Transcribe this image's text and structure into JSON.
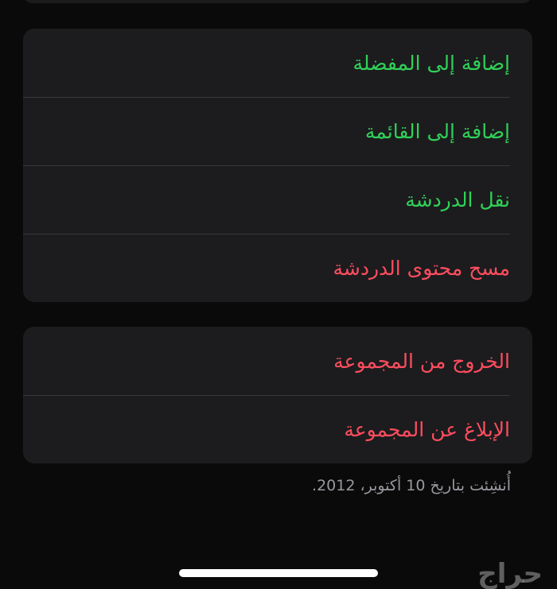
{
  "group_options": {
    "items": [
      {
        "label": "إضافة إلى المفضلة"
      },
      {
        "label": "إضافة إلى القائمة"
      },
      {
        "label": "نقل الدردشة"
      },
      {
        "label": "مسح محتوى الدردشة"
      }
    ]
  },
  "group_actions": {
    "items": [
      {
        "label": "الخروج من المجموعة"
      },
      {
        "label": "الإبلاغ عن المجموعة"
      }
    ]
  },
  "footer": {
    "created_note": "أُنشِئت بتاريخ 10 أكتوبر، 2012."
  },
  "watermark": {
    "text": "حراج"
  },
  "colors": {
    "background": "#0a0a0a",
    "card": "#1c1c1e",
    "separator": "#38383a",
    "green": "#30d158",
    "destructive": "#ff4d5e",
    "secondary_text": "#98989f"
  }
}
